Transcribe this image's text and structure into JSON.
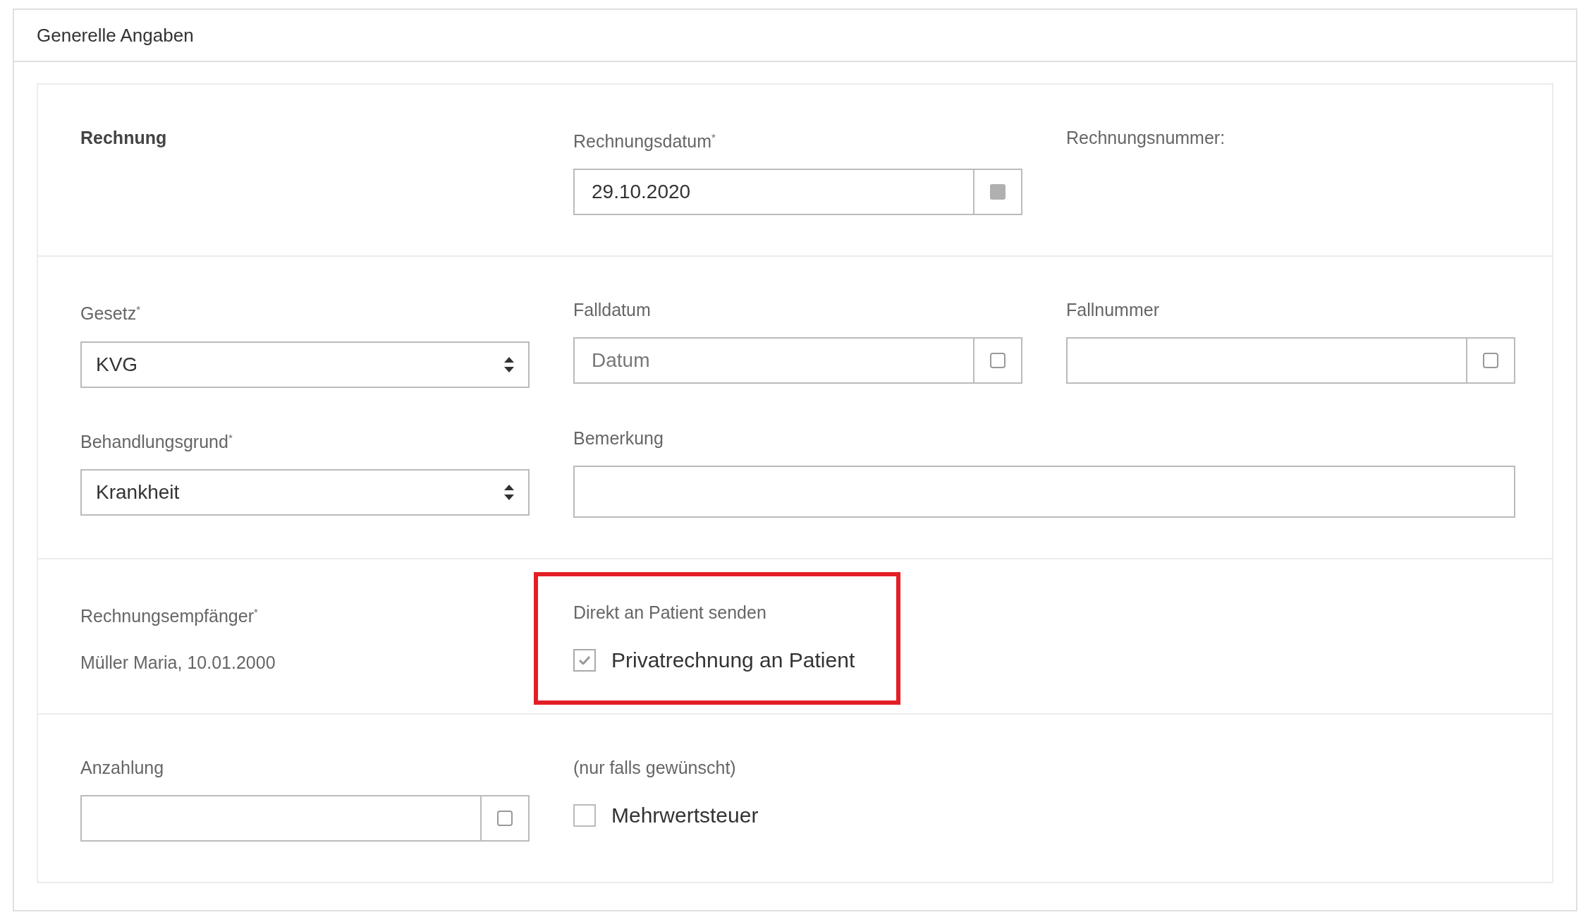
{
  "panel": {
    "title": "Generelle Angaben"
  },
  "sections": [
    {
      "rows": [
        [
          {
            "kind": "heading",
            "text": "Rechnung"
          },
          {
            "kind": "input",
            "label": "Rechnungsdatum$^{*}$",
            "value": "29.10.2020",
            "addon_filled": true
          },
          {
            "kind": "label",
            "label": "Rechnungsnummer:"
          }
        ]
      ]
    },
    {
      "rows": [
        [
          {
            "kind": "select",
            "label": "Gesetz$^{*}$",
            "value": "KVG"
          },
          {
            "kind": "input",
            "label": "Falldatum",
            "placeholder": "Datum",
            "addon_filled": false
          },
          {
            "kind": "input",
            "label": "Fallnummer",
            "addon_filled": false
          }
        ],
        [
          {
            "kind": "select",
            "label": "Behandlungsgrund$^{*}$",
            "value": "Krankheit"
          },
          {
            "kind": "textarea",
            "label": "Bemerkung"
          }
        ]
      ]
    },
    {
      "rows": [
        [
          {
            "kind": "text",
            "label": "Rechnungsempfänger$^{*}$",
            "value": "Müller Maria, 10.01.2000"
          },
          {
            "kind": "checkbox",
            "label": "Direkt an Patient senden",
            "option": "Privatrechnung an Patient",
            "checked": true,
            "highlighted": true
          }
        ]
      ]
    },
    {
      "rows": [
        [
          {
            "kind": "input",
            "label": "Anzahlung",
            "addon_filled": false
          },
          {
            "kind": "checkbox",
            "label": "(nur falls gewünscht)",
            "option": "Mehrwertsteuer",
            "checked": false,
            "highlighted": false
          }
        ]
      ]
    }
  ]
}
